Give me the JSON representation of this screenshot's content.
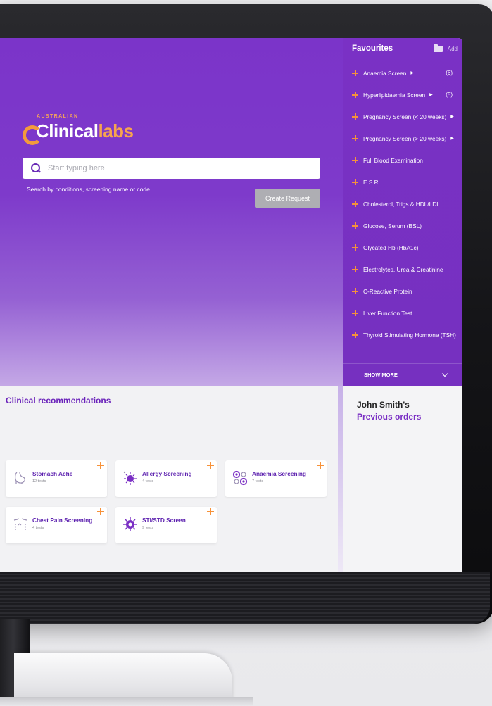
{
  "brand": {
    "top_text": "AUSTRALIAN",
    "word1": "Clinical",
    "word2": "labs"
  },
  "search": {
    "placeholder": "Start typing here",
    "hint": "Search by conditions, screening name or code"
  },
  "actions": {
    "create_request": "Create Request"
  },
  "favourites": {
    "title": "Favourites",
    "add_label": "Add",
    "items": [
      {
        "label": "Anaemia Screen",
        "arrow": "▶",
        "count": "(6)"
      },
      {
        "label": "Hyperlipidaemia Screen",
        "arrow": "▶",
        "count": "(5)"
      },
      {
        "label": "Pregnancy Screen (< 20 weeks)",
        "arrow": "▶",
        "count": ""
      },
      {
        "label": "Pregnancy Screen (> 20 weeks)",
        "arrow": "▶",
        "count": ""
      },
      {
        "label": "Full Blood Examination",
        "arrow": "",
        "count": ""
      },
      {
        "label": "E.S.R.",
        "arrow": "",
        "count": ""
      },
      {
        "label": "Cholesterol, Trigs & HDL/LDL",
        "arrow": "",
        "count": ""
      },
      {
        "label": "Glucose, Serum (BSL)",
        "arrow": "",
        "count": ""
      },
      {
        "label": "Glycated Hb (HbA1c)",
        "arrow": "",
        "count": ""
      },
      {
        "label": "Electrolytes, Urea & Creatinine",
        "arrow": "",
        "count": ""
      },
      {
        "label": "C-Reactive Protein",
        "arrow": "",
        "count": ""
      },
      {
        "label": "Liver Function Test",
        "arrow": "",
        "count": ""
      },
      {
        "label": "Thyroid Stimulating Hormone (TSH)",
        "arrow": "",
        "count": ""
      }
    ],
    "show_more": "SHOW MORE"
  },
  "recommendations": {
    "title": "Clinical recommendations",
    "cards": [
      {
        "name": "Stomach Ache",
        "sub": "12 tests",
        "icon": "stomach-icon"
      },
      {
        "name": "Allergy Screening",
        "sub": "4 tests",
        "icon": "allergy-icon"
      },
      {
        "name": "Anaemia Screening",
        "sub": "7 tests",
        "icon": "blood-cells-icon"
      },
      {
        "name": "Chest Pain Screening",
        "sub": "4 tests",
        "icon": "chest-icon"
      },
      {
        "name": "STI/STD Screen",
        "sub": "9 tests",
        "icon": "virus-icon"
      }
    ]
  },
  "orders": {
    "name": "John Smith's",
    "link": "Previous orders"
  },
  "colors": {
    "primary": "#7b34c9",
    "accent": "#f7923a",
    "button_disabled": "#aeaeb3"
  }
}
